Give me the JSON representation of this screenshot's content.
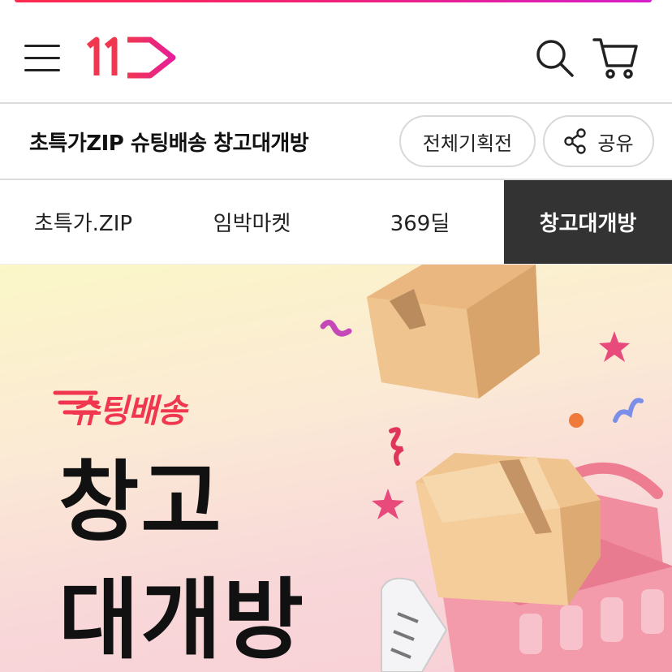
{
  "brand": {
    "logo_text": "11",
    "accent": "#f0374f",
    "gradient_end": "#e61e9a"
  },
  "header": {
    "menu_icon": "hamburger-icon",
    "search_icon": "search-icon",
    "cart_icon": "cart-icon"
  },
  "title_bar": {
    "title": "초특가ZIP 슈팅배송 창고대개방",
    "all_events_label": "전체기획전",
    "share_label": "공유",
    "share_icon": "share-icon"
  },
  "tabs": [
    {
      "label": "초특가.ZIP",
      "active": false
    },
    {
      "label": "임박마켓",
      "active": false
    },
    {
      "label": "369딜",
      "active": false
    },
    {
      "label": "창고대개방",
      "active": true
    }
  ],
  "banner": {
    "badge": "슈팅배송",
    "headline_line1": "창고",
    "headline_line2": "대개방"
  }
}
